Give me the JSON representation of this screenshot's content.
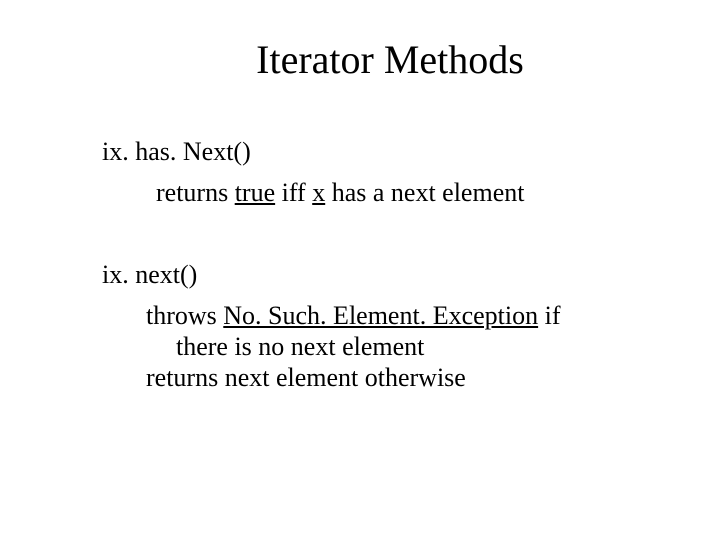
{
  "title": "Iterator Methods",
  "method1": {
    "heading": "ix. has. Next()",
    "body_pre": "returns ",
    "body_true": "true",
    "body_mid": " iff ",
    "body_x": "x",
    "body_post": " has a next element"
  },
  "method2": {
    "heading": "ix. next()",
    "line1_pre": "throws ",
    "line1_exc": "No. Such. Element. Exception",
    "line1_post": " if",
    "line2": "there is no next element",
    "line3": "returns next element otherwise"
  }
}
